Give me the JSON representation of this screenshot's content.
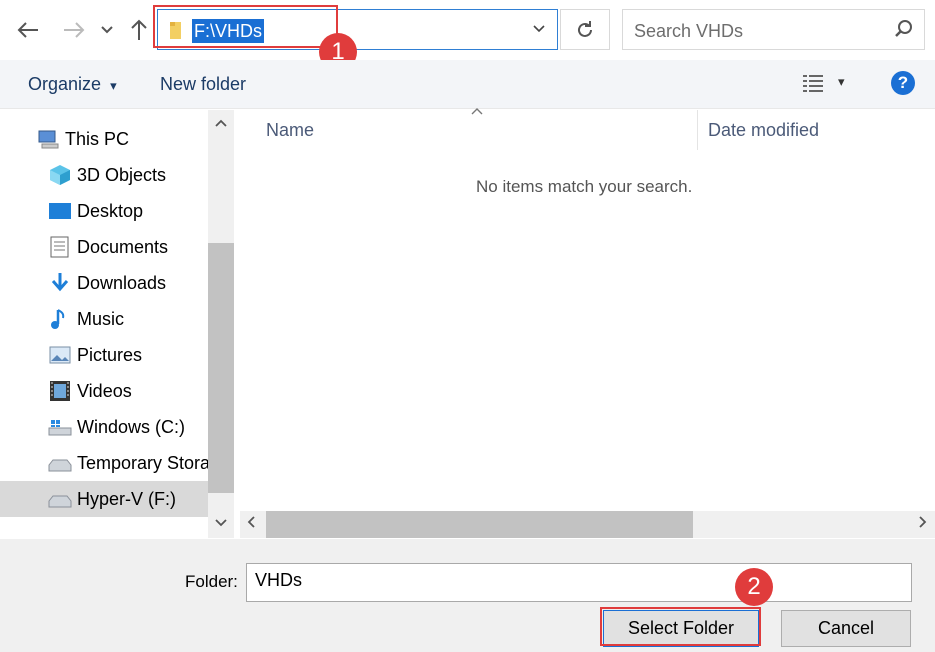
{
  "nav": {
    "back_icon": "back-arrow-icon",
    "forward_icon": "forward-arrow-icon",
    "recent_icon": "chevron-down-icon",
    "up_icon": "up-arrow-icon"
  },
  "address": {
    "path": "F:\\VHDs"
  },
  "search": {
    "placeholder": "Search VHDs"
  },
  "toolbar": {
    "organize_label": "Organize",
    "organize_caret": "▾",
    "new_folder_label": "New folder",
    "view_caret": "▾",
    "help_label": "?"
  },
  "sidebar": {
    "items": [
      {
        "label": "This PC",
        "icon": "computer-icon"
      },
      {
        "label": "3D Objects",
        "icon": "cube-icon"
      },
      {
        "label": "Desktop",
        "icon": "desktop-icon"
      },
      {
        "label": "Documents",
        "icon": "document-icon"
      },
      {
        "label": "Downloads",
        "icon": "download-icon"
      },
      {
        "label": "Music",
        "icon": "music-icon"
      },
      {
        "label": "Pictures",
        "icon": "picture-icon"
      },
      {
        "label": "Videos",
        "icon": "video-icon"
      },
      {
        "label": "Windows (C:)",
        "icon": "windows-drive-icon"
      },
      {
        "label": "Temporary Storage (D:)",
        "icon": "drive-icon"
      },
      {
        "label": "Hyper-V (F:)",
        "icon": "drive-icon"
      }
    ]
  },
  "columns": {
    "name": "Name",
    "date_modified": "Date modified"
  },
  "content": {
    "empty_message": "No items match your search."
  },
  "footer": {
    "folder_label": "Folder:",
    "folder_value": "VHDs",
    "select_button": "Select Folder",
    "cancel_button": "Cancel"
  },
  "annotations": {
    "badge1": "1",
    "badge2": "2"
  },
  "colors": {
    "accent": "#1a6fd4",
    "highlight": "#e03c3c"
  }
}
